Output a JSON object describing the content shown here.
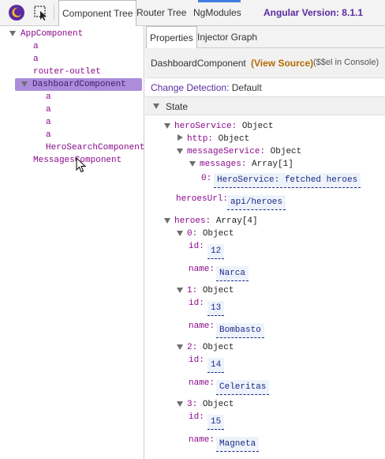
{
  "toolbar": {
    "tabs": [
      "Component Tree",
      "Router Tree",
      "NgModules"
    ],
    "angular_version": "Angular Version: 8.1.1"
  },
  "tree": {
    "nodes": [
      "AppComponent",
      "a",
      "a",
      "router-outlet",
      "DashboardComponent",
      "a",
      "a",
      "a",
      "a",
      "HeroSearchComponent",
      "MessagesComponent"
    ]
  },
  "detail": {
    "tabs": [
      "Properties",
      "Injector Graph"
    ],
    "component_name": "DashboardComponent",
    "view_source": "(View Source)",
    "console_ref": "($$el in Console)",
    "change_detection_label": "Change Detection:",
    "change_detection_value": "Default",
    "state_label": "State"
  },
  "state": {
    "heroService": {
      "key": "heroService:",
      "type": "Object"
    },
    "http": {
      "key": "http:",
      "type": "Object"
    },
    "messageService": {
      "key": "messageService:",
      "type": "Object"
    },
    "messages": {
      "key": "messages:",
      "type": "Array[1]"
    },
    "message0": {
      "key": "0:",
      "value": "HeroService: fetched heroes"
    },
    "heroesUrl": {
      "key": "heroesUrl:",
      "value": "api/heroes"
    },
    "heroes": {
      "key": "heroes:",
      "type": "Array[4]"
    },
    "hero_list": [
      {
        "key": "0:",
        "type": "Object",
        "id_key": "id:",
        "id": "12",
        "name_key": "name:",
        "name": "Narca"
      },
      {
        "key": "1:",
        "type": "Object",
        "id_key": "id:",
        "id": "13",
        "name_key": "name:",
        "name": "Bombasto"
      },
      {
        "key": "2:",
        "type": "Object",
        "id_key": "id:",
        "id": "14",
        "name_key": "name:",
        "name": "Celeritas"
      },
      {
        "key": "3:",
        "type": "Object",
        "id_key": "id:",
        "id": "15",
        "name_key": "name:",
        "name": "Magneta"
      }
    ]
  },
  "icons": [
    "angular-devtools-logo-icon",
    "inspect-element-icon",
    "mouse-cursor-icon"
  ],
  "colors": {
    "accent": "#5a2ca0",
    "selected_node": "#ab8ddb",
    "tag_name": "#8b0a8b",
    "value": "#1a2b88",
    "view_source": "#b36b00"
  }
}
